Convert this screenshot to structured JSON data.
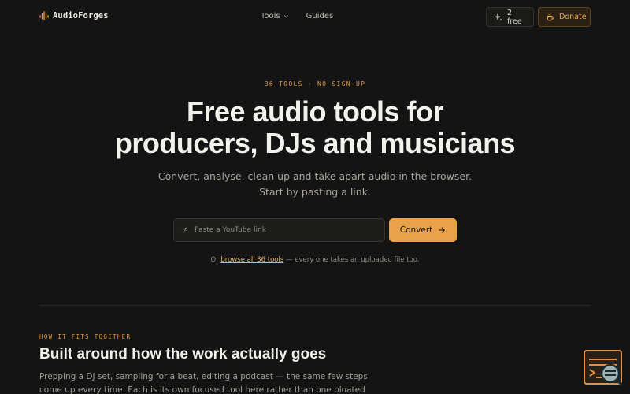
{
  "header": {
    "brand": "AudioForges",
    "nav": [
      {
        "label": "Tools",
        "has_dropdown": true
      },
      {
        "label": "Guides",
        "has_dropdown": false
      }
    ],
    "free_button": "2 free",
    "donate_button": "Donate"
  },
  "hero": {
    "eyebrow": "36 TOOLS · NO SIGN-UP",
    "headline_line1": "Free audio tools for",
    "headline_line2": "producers, DJs and musicians",
    "subhead": "Convert, analyse, clean up and take apart audio in the browser. Start by pasting a link.",
    "search_placeholder": "Paste a YouTube link",
    "search_value": "",
    "convert_button": "Convert",
    "hint_prefix": "Or ",
    "hint_link": "browse all 36 tools",
    "hint_suffix": " — every one takes an uploaded file too."
  },
  "section": {
    "eyebrow": "HOW IT FITS TOGETHER",
    "title": "Built around how the work actually goes",
    "body": "Prepping a DJ set, sampling for a beat, editing a podcast — the same few steps come up every time. Each is its own focused tool here rather than one bloated app."
  },
  "colors": {
    "background": "#141414",
    "accent": "#eaa24a",
    "text": "#f3f1ec",
    "muted": "#a8a49b"
  },
  "icons": {
    "brand": "waveform-icon",
    "free": "sparkles-icon",
    "donate": "coffee-cup-icon",
    "search": "link-icon",
    "convert": "arrow-right-icon",
    "widget": "terminal-search-icon"
  }
}
